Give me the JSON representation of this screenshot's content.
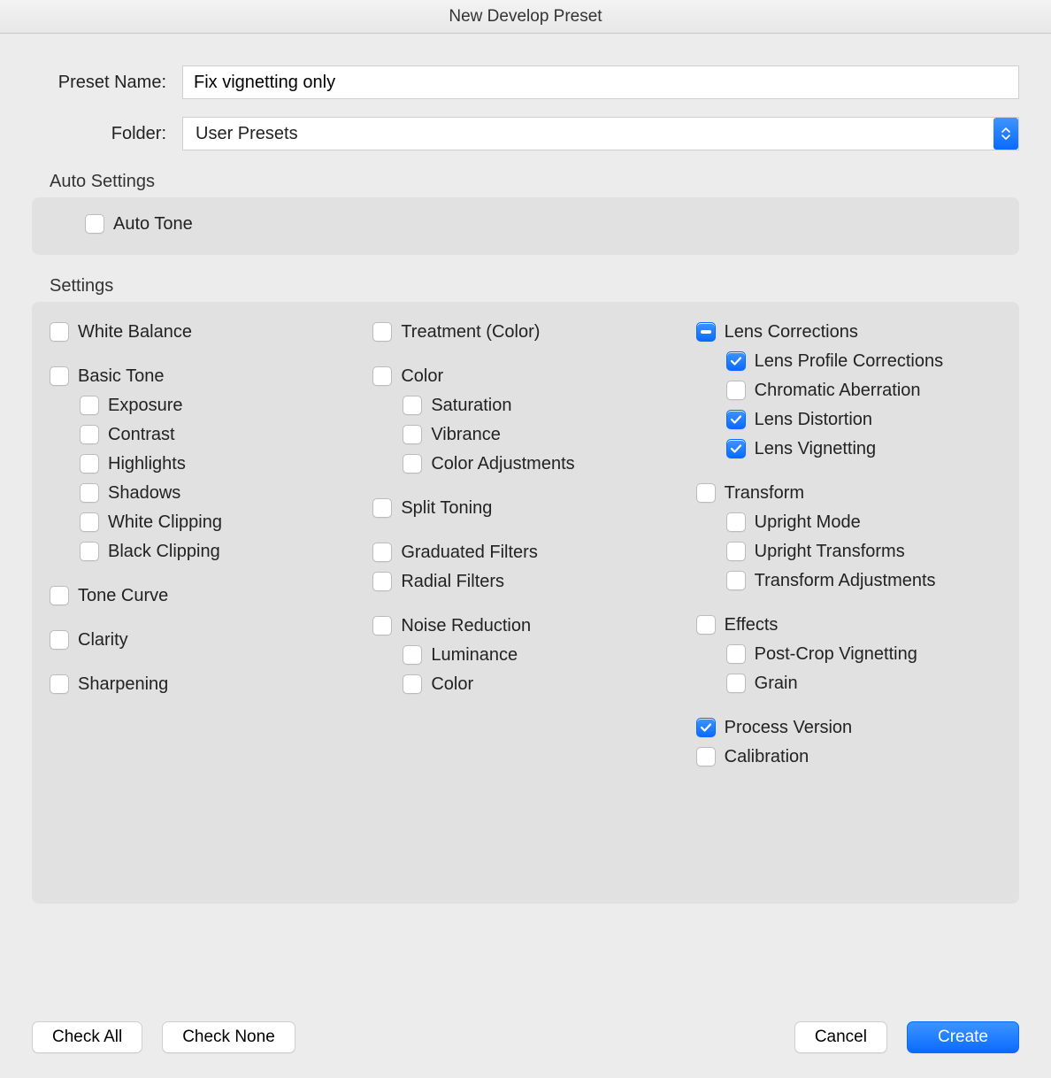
{
  "title": "New Develop Preset",
  "form": {
    "preset_name_label": "Preset Name:",
    "preset_name_value": "Fix vignetting only",
    "folder_label": "Folder:",
    "folder_value": "User Presets"
  },
  "sections": {
    "auto_settings_label": "Auto Settings",
    "auto_tone": {
      "label": "Auto Tone",
      "state": "off"
    },
    "settings_label": "Settings"
  },
  "col1": {
    "white_balance": {
      "label": "White Balance",
      "state": "off"
    },
    "basic_tone": {
      "label": "Basic Tone",
      "state": "off"
    },
    "exposure": {
      "label": "Exposure",
      "state": "off"
    },
    "contrast": {
      "label": "Contrast",
      "state": "off"
    },
    "highlights": {
      "label": "Highlights",
      "state": "off"
    },
    "shadows": {
      "label": "Shadows",
      "state": "off"
    },
    "white_clipping": {
      "label": "White Clipping",
      "state": "off"
    },
    "black_clipping": {
      "label": "Black Clipping",
      "state": "off"
    },
    "tone_curve": {
      "label": "Tone Curve",
      "state": "off"
    },
    "clarity": {
      "label": "Clarity",
      "state": "off"
    },
    "sharpening": {
      "label": "Sharpening",
      "state": "off"
    }
  },
  "col2": {
    "treatment": {
      "label": "Treatment (Color)",
      "state": "off"
    },
    "color": {
      "label": "Color",
      "state": "off"
    },
    "saturation": {
      "label": "Saturation",
      "state": "off"
    },
    "vibrance": {
      "label": "Vibrance",
      "state": "off"
    },
    "color_adjustments": {
      "label": "Color Adjustments",
      "state": "off"
    },
    "split_toning": {
      "label": "Split Toning",
      "state": "off"
    },
    "graduated_filters": {
      "label": "Graduated Filters",
      "state": "off"
    },
    "radial_filters": {
      "label": "Radial Filters",
      "state": "off"
    },
    "noise_reduction": {
      "label": "Noise Reduction",
      "state": "off"
    },
    "luminance": {
      "label": "Luminance",
      "state": "off"
    },
    "nr_color": {
      "label": "Color",
      "state": "off"
    }
  },
  "col3": {
    "lens_corrections": {
      "label": "Lens Corrections",
      "state": "mixed"
    },
    "lens_profile": {
      "label": "Lens Profile Corrections",
      "state": "on"
    },
    "chromatic": {
      "label": "Chromatic Aberration",
      "state": "off"
    },
    "lens_distortion": {
      "label": "Lens Distortion",
      "state": "on"
    },
    "lens_vignetting": {
      "label": "Lens Vignetting",
      "state": "on"
    },
    "transform": {
      "label": "Transform",
      "state": "off"
    },
    "upright_mode": {
      "label": "Upright Mode",
      "state": "off"
    },
    "upright_transforms": {
      "label": "Upright Transforms",
      "state": "off"
    },
    "transform_adjustments": {
      "label": "Transform Adjustments",
      "state": "off"
    },
    "effects": {
      "label": "Effects",
      "state": "off"
    },
    "postcrop": {
      "label": "Post-Crop Vignetting",
      "state": "off"
    },
    "grain": {
      "label": "Grain",
      "state": "off"
    },
    "process_version": {
      "label": "Process Version",
      "state": "on"
    },
    "calibration": {
      "label": "Calibration",
      "state": "off"
    }
  },
  "buttons": {
    "check_all": "Check All",
    "check_none": "Check None",
    "cancel": "Cancel",
    "create": "Create"
  }
}
